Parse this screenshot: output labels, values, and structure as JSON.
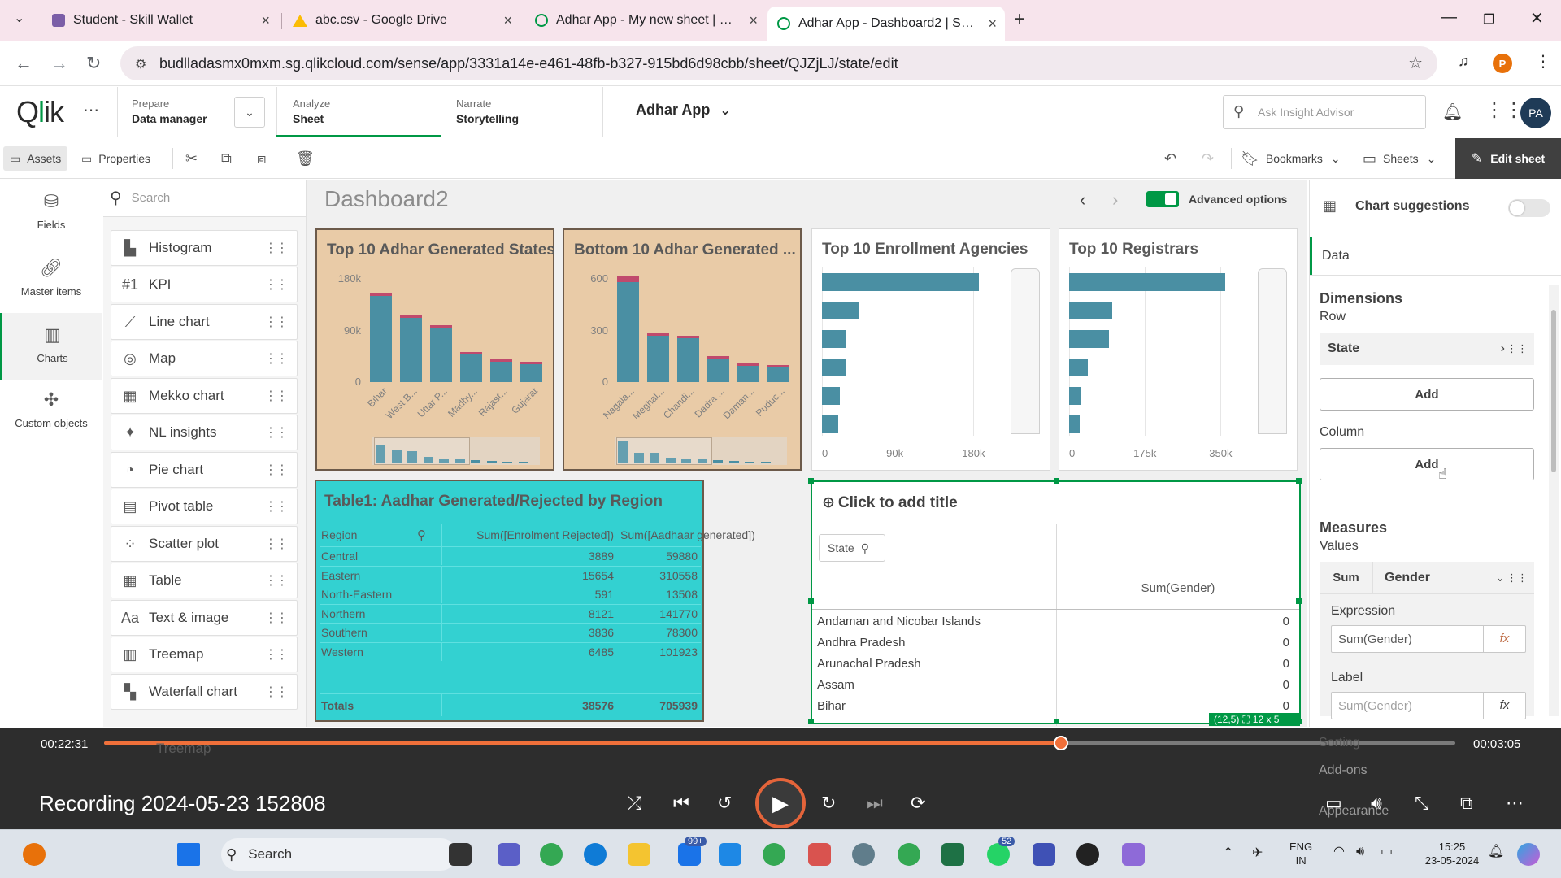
{
  "browser": {
    "tabs": [
      {
        "title": "Student - Skill Wallet",
        "icon": "skill-wallet-icon"
      },
      {
        "title": "abc.csv - Google Drive",
        "icon": "google-drive-icon"
      },
      {
        "title": "Adhar App - My new sheet | Sh",
        "icon": "qlik-icon"
      },
      {
        "title": "Adhar App - Dashboard2 | Shee",
        "icon": "qlik-icon",
        "active": true
      }
    ],
    "url": "budlladasmx0mxm.sg.qlikcloud.com/sense/app/3331a14e-e461-48fb-b327-915bd6d98cbb/sheet/QJZjLJ/state/edit",
    "profile_initial": "P"
  },
  "qlik": {
    "nav": [
      {
        "small": "Prepare",
        "big": "Data manager"
      },
      {
        "small": "Analyze",
        "big": "Sheet"
      },
      {
        "small": "Narrate",
        "big": "Storytelling"
      }
    ],
    "app_name": "Adhar App",
    "search_placeholder": "Ask Insight Advisor",
    "user_initials": "PA"
  },
  "toolbar": {
    "assets": "Assets",
    "properties": "Properties",
    "bookmarks": "Bookmarks",
    "sheets": "Sheets",
    "edit_sheet": "Edit sheet"
  },
  "left_rail": [
    {
      "label": "Fields",
      "icon": "database-icon"
    },
    {
      "label": "Master items",
      "icon": "link-icon"
    },
    {
      "label": "Charts",
      "icon": "bar-chart-icon",
      "active": true
    },
    {
      "label": "Custom objects",
      "icon": "puzzle-icon"
    }
  ],
  "assets": {
    "search_placeholder": "Search",
    "charts": [
      {
        "label": "Histogram",
        "icon": "histogram-icon"
      },
      {
        "label": "KPI",
        "icon": "kpi-icon"
      },
      {
        "label": "Line chart",
        "icon": "line-chart-icon"
      },
      {
        "label": "Map",
        "icon": "map-icon"
      },
      {
        "label": "Mekko chart",
        "icon": "mekko-chart-icon"
      },
      {
        "label": "NL insights",
        "icon": "nl-insights-icon"
      },
      {
        "label": "Pie chart",
        "icon": "pie-chart-icon"
      },
      {
        "label": "Pivot table",
        "icon": "pivot-table-icon"
      },
      {
        "label": "Scatter plot",
        "icon": "scatter-plot-icon"
      },
      {
        "label": "Table",
        "icon": "table-icon"
      },
      {
        "label": "Text & image",
        "icon": "text-image-icon"
      },
      {
        "label": "Treemap",
        "icon": "treemap-icon"
      },
      {
        "label": "Waterfall chart",
        "icon": "waterfall-chart-icon"
      }
    ]
  },
  "sheet": {
    "title": "Dashboard2",
    "advanced_options": "Advanced options"
  },
  "chart_data": [
    {
      "type": "bar",
      "title": "Top 10 Adhar Generated States",
      "categories": [
        "Bihar",
        "West B...",
        "Uttar P...",
        "Madhy...",
        "Rajast...",
        "Gujarat"
      ],
      "series": [
        {
          "values": [
            150000,
            112000,
            95000,
            50000,
            38000,
            34000
          ]
        },
        {
          "values": [
            5000,
            4000,
            4000,
            3000,
            2000,
            2000
          ]
        }
      ],
      "y_ticks": [
        "180k",
        "90k",
        "0"
      ],
      "ylim": [
        0,
        180000
      ]
    },
    {
      "type": "bar",
      "title": "Bottom 10 Adhar Generated ...",
      "categories": [
        "Nagala...",
        "Meghal...",
        "Chandi...",
        "Dadra ...",
        "Daman...",
        "Puduc..."
      ],
      "series": [
        {
          "values": [
            580,
            285,
            270,
            150,
            110,
            100
          ]
        },
        {
          "values": [
            40,
            0,
            0,
            0,
            0,
            0
          ]
        }
      ],
      "y_ticks": [
        "600",
        "300",
        "0"
      ],
      "ylim": [
        0,
        600
      ]
    },
    {
      "type": "bar",
      "orientation": "horizontal",
      "title": "Top 10 Enrollment Agencies",
      "values": [
        173000,
        40000,
        26000,
        26000,
        20000,
        18000
      ],
      "x_ticks": [
        "0",
        "90k",
        "180k"
      ],
      "xlim": [
        0,
        200000
      ]
    },
    {
      "type": "bar",
      "orientation": "horizontal",
      "title": "Top 10 Registrars",
      "values": [
        332000,
        92000,
        85000,
        40000,
        25000,
        22000
      ],
      "x_ticks": [
        "0",
        "175k",
        "350k"
      ],
      "xlim": [
        0,
        385000
      ]
    },
    {
      "type": "table",
      "title": "Table1: Aadhar Generated/Rejected by Region",
      "columns": [
        "Region",
        "Sum([Enrolment Rejected])",
        "Sum([Aadhaar generated])"
      ],
      "rows": [
        [
          "Central",
          "3889",
          "59880"
        ],
        [
          "Eastern",
          "15654",
          "310558"
        ],
        [
          "North-Eastern",
          "591",
          "13508"
        ],
        [
          "Northern",
          "8121",
          "141770"
        ],
        [
          "Southern",
          "3836",
          "78300"
        ],
        [
          "Western",
          "6485",
          "101923"
        ]
      ],
      "totals": [
        "Totals",
        "38576",
        "705939"
      ]
    },
    {
      "type": "table",
      "title": "Click to add title",
      "dimension": "State",
      "measure": "Sum(Gender)",
      "rows": [
        [
          "Andaman and Nicobar Islands",
          "0"
        ],
        [
          "Andhra Pradesh",
          "0"
        ],
        [
          "Arunachal Pradesh",
          "0"
        ],
        [
          "Assam",
          "0"
        ],
        [
          "Bihar",
          "0"
        ]
      ],
      "grid_status": "(12,5)",
      "size_status": "12 x 5"
    }
  ],
  "properties": {
    "chart_suggestions": "Chart suggestions",
    "data_tab": "Data",
    "dimensions_head": "Dimensions",
    "row_label": "Row",
    "row_field": "State",
    "add_label": "Add",
    "column_label": "Column",
    "measures_head": "Measures",
    "values_label": "Values",
    "measure_agg": "Sum",
    "measure_field": "Gender",
    "expression_label": "Expression",
    "expression_value": "Sum(Gender)",
    "label_label": "Label",
    "label_placeholder": "Sum(Gender)",
    "sorting": "Sorting",
    "addons": "Add-ons",
    "appearance": "Appearance"
  },
  "player": {
    "elapsed": "00:22:31",
    "remaining": "00:03:05",
    "progress_fraction": 0.708,
    "title": "Recording 2024-05-23 152808"
  },
  "taskbar": {
    "search_placeholder": "Search",
    "lang_top": "ENG",
    "lang_bottom": "IN",
    "time": "15:25",
    "date": "23-05-2024",
    "badges": [
      "99+",
      "52"
    ]
  },
  "colors": {
    "accent_green": "#009845",
    "bar_teal": "#4a8fa3",
    "bar_red": "#c04a6d",
    "card_tan": "#e9cba7",
    "table_cyan": "#33d1d1",
    "seek_orange": "#f0703a"
  }
}
